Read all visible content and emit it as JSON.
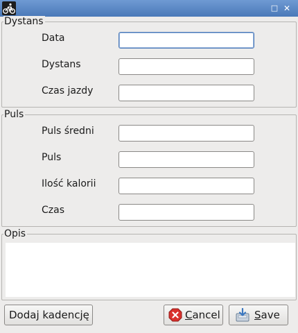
{
  "window": {
    "title": "",
    "app_icon": "bicycle-icon",
    "maximize_icon": "maximize-icon",
    "close_icon": "close-icon",
    "maximize_glyph": "□",
    "close_glyph": "✕"
  },
  "dystans_group": {
    "legend": "Dystans",
    "fields": [
      {
        "label": "Data",
        "value": "",
        "focused": true
      },
      {
        "label": "Dystans",
        "value": ""
      },
      {
        "label": "Czas jazdy",
        "value": ""
      }
    ]
  },
  "puls_group": {
    "legend": "Puls",
    "fields": [
      {
        "label": "Puls średni",
        "value": ""
      },
      {
        "label": "Puls",
        "value": ""
      },
      {
        "label": "Ilość kalorii",
        "value": ""
      },
      {
        "label": "Czas",
        "value": ""
      }
    ]
  },
  "opis_group": {
    "legend": "Opis",
    "value": ""
  },
  "buttons": {
    "add_cadence": "Dodaj kadencję",
    "cancel": "Cancel",
    "cancel_mnemonic": "C",
    "cancel_rest": "ancel",
    "cancel_icon": "cancel-icon",
    "save": "Save",
    "save_mnemonic": "S",
    "save_rest": "ave",
    "save_icon": "save-icon"
  },
  "colors": {
    "titlebar": "#4a79b8",
    "cancel_icon": "#d9302c",
    "field_focus_border": "#4a79b8"
  }
}
